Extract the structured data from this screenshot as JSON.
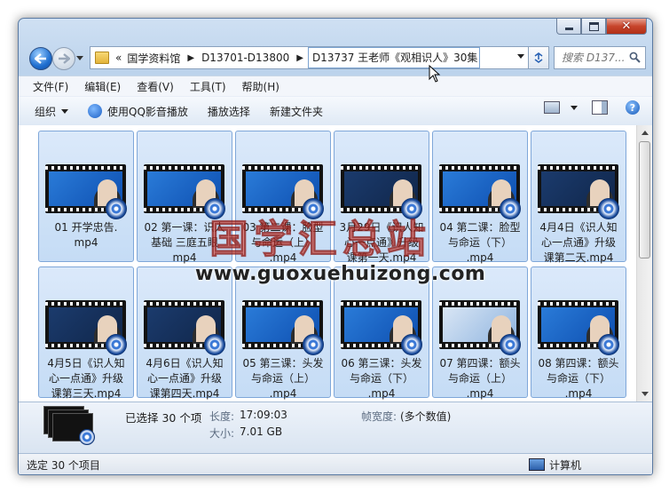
{
  "window": {
    "title_buttons": [
      "minimize",
      "maximize",
      "close"
    ]
  },
  "nav": {
    "breadcrumb_overflow": "«",
    "breadcrumbs": [
      "国学资料馆",
      "D13701-D13800",
      "D13737 王老师《观相识人》30集"
    ],
    "search_placeholder": "搜索 D137..."
  },
  "menu": [
    "文件(F)",
    "编辑(E)",
    "查看(V)",
    "工具(T)",
    "帮助(H)"
  ],
  "toolbar": {
    "organize": "组织",
    "play_qq": "使用QQ影音播放",
    "play_select": "播放选择",
    "new_folder": "新建文件夹"
  },
  "files": [
    {
      "name": "01 开学忠告.\nmp4",
      "screen": "blue"
    },
    {
      "name": "02 第一课：识人\n基础 三庭五眼\nmp4",
      "screen": "blue"
    },
    {
      "name": "03 第二课：脸型\n与命运（上）\n.mp4",
      "screen": "blue"
    },
    {
      "name": "3月29日《识人知\n心一点通》升级\n课第一天.mp4",
      "screen": "dark"
    },
    {
      "name": "04 第二课：脸型\n与命运（下）\n.mp4",
      "screen": "blue"
    },
    {
      "name": "4月4日《识人知\n心一点通》升级\n课第二天.mp4",
      "screen": "dark"
    },
    {
      "name": "4月5日《识人知\n心一点通》升级\n课第三天.mp4",
      "screen": "dark"
    },
    {
      "name": "4月6日《识人知\n心一点通》升级\n课第四天.mp4",
      "screen": "dark"
    },
    {
      "name": "05 第三课：头发\n与命运（上）\n.mp4",
      "screen": "blue"
    },
    {
      "name": "06 第三课：头发\n与命运（下）\n.mp4",
      "screen": "blue"
    },
    {
      "name": "07 第四课：额头\n与命运（上）\n.mp4",
      "screen": "light"
    },
    {
      "name": "08 第四课：额头\n与命运（下）\n.mp4",
      "screen": "blue"
    }
  ],
  "details": {
    "selected": "已选择 30 个项",
    "length_label": "长度:",
    "length_value": "17:09:03",
    "size_label": "大小:",
    "size_value": "7.01 GB",
    "framewidth_label": "帧宽度:",
    "framewidth_value": "(多个数值)"
  },
  "status": {
    "left": "选定 30 个项目",
    "right": "计算机"
  },
  "watermark": {
    "cn": "国学汇总站",
    "en": "www.guoxuehuizong.com"
  }
}
